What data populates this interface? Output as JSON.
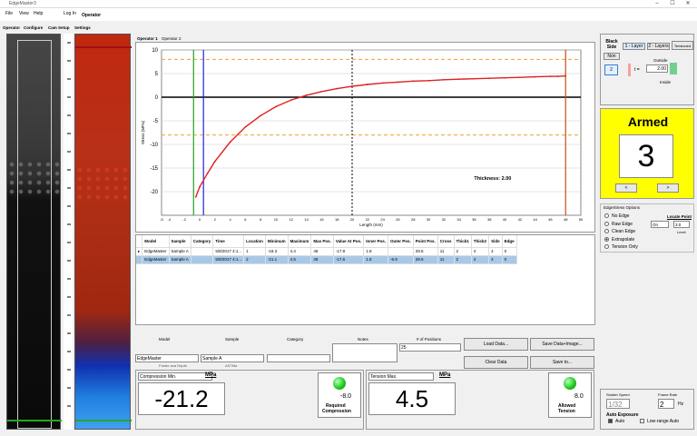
{
  "window": {
    "title": "EdgeMaster3"
  },
  "menu": {
    "file": "File",
    "view": "View",
    "help": "Help",
    "login_label": "Log In",
    "user": "Operator"
  },
  "left_tabs": [
    "Operator",
    "Configure",
    "Cam Setup",
    "Settings"
  ],
  "chart_tabs": [
    "Operator 1",
    "Operator 2"
  ],
  "chart_data": {
    "type": "line",
    "title": "",
    "xlabel": "Length (mm)",
    "ylabel": "Stress (MPa)",
    "xlim": [
      -5,
      50
    ],
    "ylim": [
      -25,
      10
    ],
    "x_ticks": [
      -5,
      -4,
      -2,
      0,
      2,
      4,
      6,
      8,
      10,
      12,
      14,
      16,
      18,
      20,
      22,
      24,
      26,
      28,
      30,
      32,
      34,
      36,
      38,
      40,
      42,
      44,
      46,
      48,
      50
    ],
    "y_ticks": [
      10,
      5,
      0,
      -5,
      -10,
      -15,
      -20
    ],
    "grid": true,
    "series": [
      {
        "x": [
          -0.5,
          0,
          1,
          2,
          4,
          6,
          8,
          10,
          12,
          14,
          16,
          18,
          20,
          22,
          24,
          26,
          28,
          30,
          32,
          34,
          36,
          38,
          40,
          42,
          44,
          46,
          47,
          48
        ],
        "y": [
          -21.1,
          -19,
          -16.2,
          -13.6,
          -9.5,
          -6.3,
          -3.9,
          -2.0,
          -0.6,
          0.4,
          1.2,
          1.8,
          2.3,
          2.7,
          3.0,
          3.2,
          3.4,
          3.5,
          3.7,
          3.8,
          3.9,
          4.0,
          4.1,
          4.2,
          4.3,
          4.4,
          4.4,
          4.5
        ]
      }
    ],
    "limit_lines": [
      8,
      -8
    ],
    "colors": {
      "series": "#e02020",
      "limit": "#f0a030",
      "zero": "#000000",
      "green": "#20a020",
      "blue": "#2020e0",
      "orange_line": "#c05010"
    },
    "vlines": {
      "green": -0.8,
      "blue": 0.5,
      "dashed": 20,
      "orange": 48
    },
    "annotation": "Thickness: 2.00"
  },
  "table": {
    "headers": [
      "Model",
      "Sample",
      "Category",
      "Time",
      "Location",
      "Minimum",
      "Maximum",
      "Max Pos.",
      "Value At Pos.",
      "Inner Pos.",
      "Outer Pos.",
      "Point Pos.",
      "Cross",
      "Thick1",
      "Thick2",
      "Side",
      "Edge"
    ],
    "rows": [
      [
        "EdgeMaster",
        "Sample A",
        "",
        "5/8/2017 4:1...",
        "1",
        "-18.3",
        "4.4",
        "48",
        "-17.8",
        "1.8",
        "",
        "29.6",
        "11",
        "2",
        "4",
        "4",
        "0"
      ],
      [
        "EdgeMaster",
        "Sample A",
        "",
        "5/8/2017 4:1...",
        "2",
        "-21.1",
        "4.5",
        "48",
        "-17.6",
        "1.8",
        "-6.9",
        "29.6",
        "11",
        "2",
        "4",
        "4",
        "0"
      ]
    ]
  },
  "form": {
    "model_label": "Model",
    "sample_label": "Sample",
    "category_label": "Category",
    "notes_label": "Notes",
    "positions_label": "# of Positions",
    "model_value": "EdgeMaster",
    "sample_value": "Sample A",
    "category_value": "",
    "positions_value": "25",
    "model_hint": "Folder and Depth",
    "sample_hint": "ASTMa",
    "load_data": "Load Data...",
    "clear_data": "Clear Data",
    "save_data_image": "Save Data+Image...",
    "save_to": "Save to..."
  },
  "compression": {
    "label": "Compression Min.",
    "unit": "MPa",
    "value": "-21.2",
    "required_value": "-8.0",
    "required_label1": "Required",
    "required_label2": "Compression"
  },
  "tension": {
    "label": "Tension Max.",
    "unit": "MPa",
    "value": "4.5",
    "allowed_value": "8.0",
    "allowed_label1": "Allowed",
    "allowed_label2": "Tension"
  },
  "right": {
    "side_label": "Black Side",
    "side_value": "Non",
    "side_count": "2",
    "layer1": "1 - Layer",
    "layer2": "2 - Layers",
    "tensioned": "Tensioned",
    "outside": "Outside",
    "inside": "Inside",
    "t_label": "t =",
    "t_value": "2.00",
    "armed_title": "Armed",
    "armed_number": "3",
    "prev": "<",
    "next": ">",
    "options_title": "EdgeStress Options",
    "options": [
      "No Edge",
      "Raw Edge",
      "Clean Edge",
      "Extrapolate",
      "Tension Only"
    ],
    "selected_option": "Extrapolate",
    "locate_point": "Locate Point",
    "locate_on": "On",
    "locate_num": "3.0",
    "level": "Level",
    "shutter_label": "Shutter Speed",
    "shutter_value": "1/32",
    "frame_label": "Frame Rate",
    "frame_value": "2",
    "hz": "Hz",
    "auto_exposure": "Auto Exposure",
    "auto": "Auto",
    "low_range": "Low-range Auto"
  }
}
